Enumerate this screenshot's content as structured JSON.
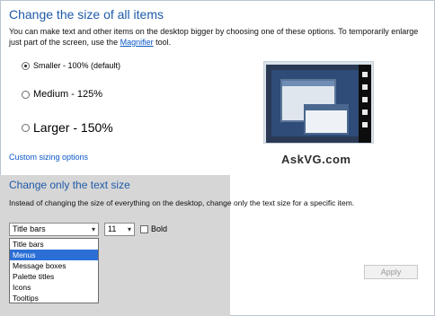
{
  "header": {
    "title": "Change the size of all items",
    "description_before_link": "You can make text and other items on the desktop bigger by choosing one of these options. To temporarily enlarge just part of the screen, use the ",
    "link": "Magnifier",
    "description_after_link": " tool."
  },
  "size_options": [
    {
      "label": "Smaller - 100% (default)",
      "checked": true
    },
    {
      "label": "Medium - 125%",
      "checked": false
    },
    {
      "label": "Larger - 150%",
      "checked": false
    }
  ],
  "custom_link": "Custom sizing options",
  "watermark": "AskVG.com",
  "text_size": {
    "title": "Change only the text size",
    "description": "Instead of changing the size of everything on the desktop, change only the text size for a specific item.",
    "item_select_value": "Title bars",
    "size_select_value": "11",
    "bold_label": "Bold",
    "bold_checked": false,
    "dropdown_items": [
      "Title bars",
      "Menus",
      "Message boxes",
      "Palette titles",
      "Icons",
      "Tooltips"
    ],
    "dropdown_selected_index": 1
  },
  "apply_button": "Apply",
  "colors": {
    "heading": "#1e5aa8",
    "link": "#0b57c8",
    "selection": "#2b6fd6",
    "panel_gray": "#d6d6d6"
  },
  "icons": {
    "dropdown_arrow": "chevron-down-icon",
    "preview": "display-preview-icon"
  }
}
